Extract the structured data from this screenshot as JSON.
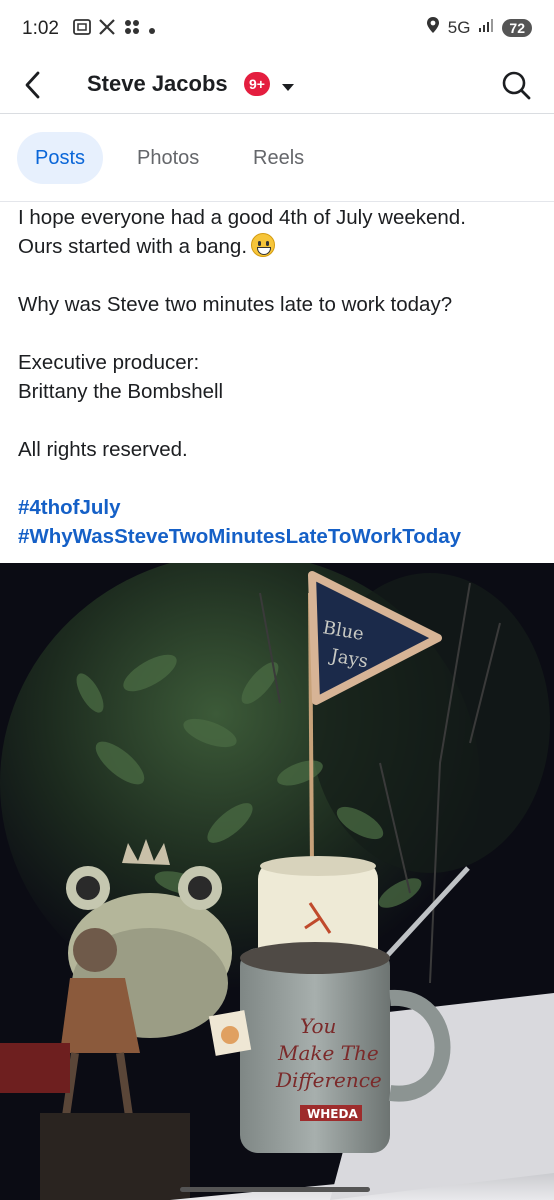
{
  "status_bar": {
    "time": "1:02",
    "network": "5G",
    "battery": "72"
  },
  "header": {
    "title": "Steve Jacobs",
    "badge": "9+"
  },
  "tabs": [
    {
      "label": "Posts",
      "active": true
    },
    {
      "label": "Photos",
      "active": false
    },
    {
      "label": "Reels",
      "active": false
    }
  ],
  "post": {
    "line1": "I hope everyone had a good 4th of July weekend.",
    "line2": "Ours started with a bang.",
    "line3": "Why was Steve two minutes late to work today?",
    "line4": "Executive producer:",
    "line5": "Brittany the Bombshell",
    "line6": "All rights reserved.",
    "hashtags": [
      "#4thofJuly",
      "#WhyWasSteveTwoMinutesLateToWorkToday"
    ]
  },
  "photo": {
    "flag_text_1": "Blue",
    "flag_text_2": "Jays",
    "mug_text_1": "You",
    "mug_text_2": "Make The",
    "mug_text_3": "Difference",
    "mug_logo": "WHEDA"
  },
  "colors": {
    "accent": "#0a66d8",
    "hashtag": "#1560c7",
    "badge": "#e41e3f",
    "active_tab_bg": "#e7f0fd"
  },
  "icons": [
    "back-arrow-icon",
    "dropdown-caret-icon",
    "search-icon",
    "location-icon",
    "signal-icon",
    "battery-icon",
    "x-logo-icon",
    "screenshot-icon",
    "pinwheel-icon",
    "grinning-emoji-icon"
  ]
}
